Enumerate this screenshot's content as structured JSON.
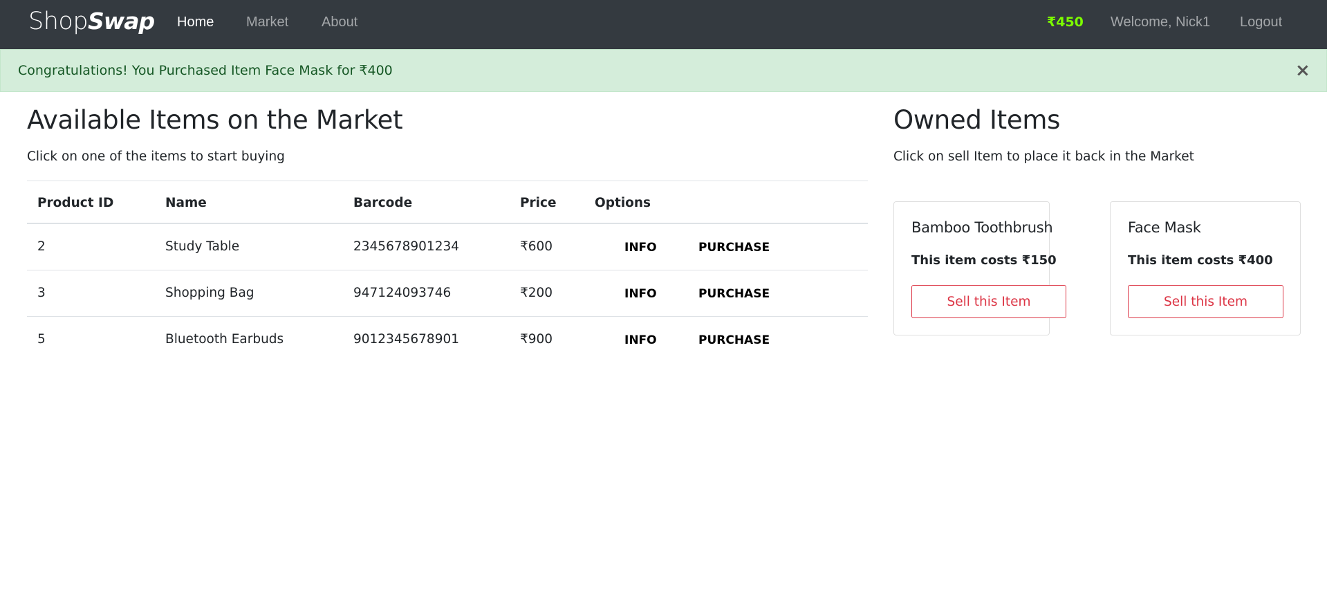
{
  "navbar": {
    "brand_light": "Shop",
    "brand_bold": "Swap",
    "links": [
      "Home",
      "Market",
      "About"
    ],
    "budget": "₹450",
    "welcome": "Welcome, Nick1",
    "logout": "Logout"
  },
  "alert": {
    "message": "Congratulations! You Purchased Item Face Mask for ₹400",
    "close": "×",
    "colors": {
      "background": "#d4edda",
      "text": "#155724"
    }
  },
  "market": {
    "title": "Available Items on the Market",
    "subtitle": "Click on one of the items to start buying",
    "columns": [
      "Product ID",
      "Name",
      "Barcode",
      "Price",
      "Options"
    ],
    "rows": [
      {
        "id": "2",
        "name": "Study Table",
        "barcode": "2345678901234",
        "price": "₹600",
        "info": "INFO",
        "purchase": "PURCHASE"
      },
      {
        "id": "3",
        "name": "Shopping Bag",
        "barcode": "947124093746",
        "price": "₹200",
        "info": "INFO",
        "purchase": "PURCHASE"
      },
      {
        "id": "5",
        "name": "Bluetooth Earbuds",
        "barcode": "9012345678901",
        "price": "₹900",
        "info": "INFO",
        "purchase": "PURCHASE"
      }
    ]
  },
  "owned": {
    "title": "Owned Items",
    "subtitle": "Click on sell Item to place it back in the Market",
    "cards": [
      {
        "name": "Bamboo Toothbrush",
        "cost_text": "This item costs ₹150",
        "sell_label": "Sell this Item"
      },
      {
        "name": "Face Mask",
        "cost_text": "This item costs ₹400",
        "sell_label": "Sell this Item"
      }
    ]
  },
  "colors": {
    "navbar": "#343a40",
    "budget": "#7cfc00",
    "sell_button": "#dc3545"
  }
}
